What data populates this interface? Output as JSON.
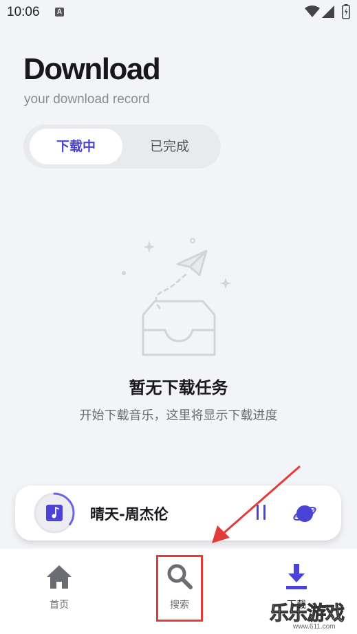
{
  "status_bar": {
    "time": "10:06",
    "notification_icon": "A"
  },
  "header": {
    "title": "Download",
    "subtitle": "your download record"
  },
  "tabs": [
    {
      "label": "下载中",
      "active": true
    },
    {
      "label": "已完成",
      "active": false
    }
  ],
  "empty_state": {
    "title": "暂无下载任务",
    "description": "开始下载音乐，这里将显示下载进度",
    "illustration": "empty-inbox-paper-plane"
  },
  "player": {
    "song": "晴天-周杰伦",
    "progress": 0.35,
    "accent_color": "#4a43d6"
  },
  "nav": {
    "items": [
      {
        "label": "首页",
        "icon": "home-icon"
      },
      {
        "label": "搜索",
        "icon": "search-icon"
      },
      {
        "label": "下载",
        "icon": "download-icon",
        "active": true
      }
    ]
  },
  "watermark": {
    "text": "乐乐游戏",
    "url": "www.611.com"
  }
}
